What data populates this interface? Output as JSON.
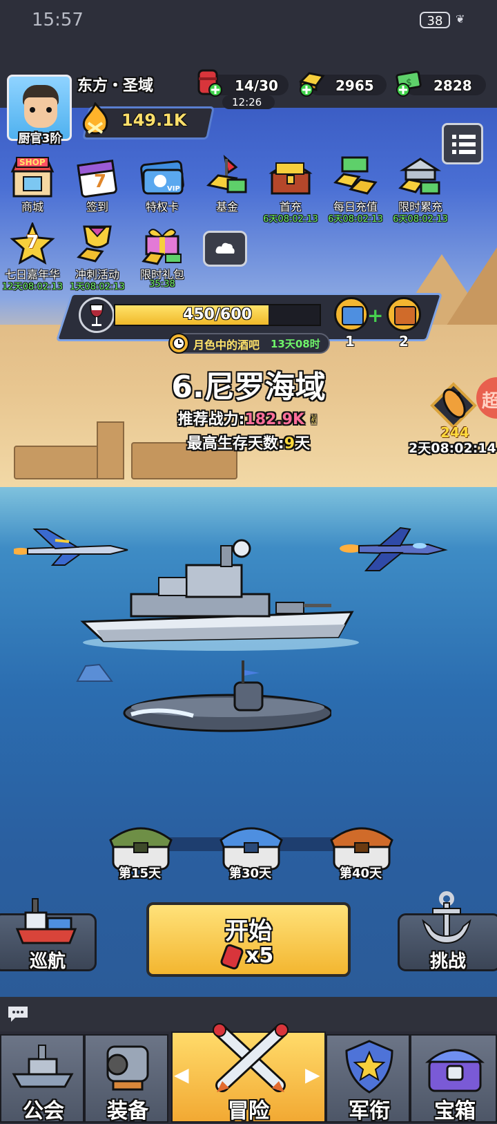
{
  "status_bar": {
    "time": "15:57",
    "battery": "38"
  },
  "player": {
    "name": "东方・圣域",
    "rank": "厨官3阶",
    "power": "149.1K"
  },
  "resources": [
    {
      "icon": "fuel-barrel-icon",
      "value": "14/30",
      "timer": "12:26"
    },
    {
      "icon": "gold-bars-icon",
      "value": "2965"
    },
    {
      "icon": "cash-icon",
      "value": "2828"
    }
  ],
  "menu_row1": [
    {
      "label": "商城",
      "icon": "shop-icon",
      "badge": "SHOP",
      "timer": ""
    },
    {
      "label": "签到",
      "icon": "calendar-icon",
      "badge": "7",
      "timer": ""
    },
    {
      "label": "特权卡",
      "icon": "vip-card-icon",
      "badge": "VIP",
      "timer": ""
    },
    {
      "label": "基金",
      "icon": "fund-icon",
      "timer": ""
    },
    {
      "label": "首充",
      "icon": "treasure-chest-icon",
      "timer": "6天08:02:13"
    },
    {
      "label": "每日充值",
      "icon": "gold-pile-icon",
      "timer": "6天08:02:13"
    },
    {
      "label": "限时累充",
      "icon": "vault-icon",
      "timer": "6天08:02:13"
    }
  ],
  "menu_row2": [
    {
      "label": "七日嘉年华",
      "icon": "seven-day-star-icon",
      "badge": "7",
      "timer": "12天08:02:13"
    },
    {
      "label": "冲刺活动",
      "icon": "sprint-trophy-icon",
      "timer": "1天08:02:13"
    },
    {
      "label": "限时礼包",
      "icon": "gift-box-icon",
      "timer": "35:38"
    }
  ],
  "event": {
    "progress_text": "450/600",
    "progress_fraction": 0.75,
    "name": "月色中的酒吧",
    "time_left": "13天08时",
    "chest1_count": "1",
    "chest2_count": "2"
  },
  "stage": {
    "title": "6.尼罗海域",
    "recommend_label": "推荐战力:",
    "recommend_value": "182.9K",
    "best_label": "最高生存天数:",
    "best_value": "9",
    "best_unit": "天"
  },
  "side_event": {
    "count": "244",
    "timer": "2天08:02:14",
    "edge_label": "超"
  },
  "milestones": [
    {
      "label": "第15天"
    },
    {
      "label": "第30天"
    },
    {
      "label": "第40天"
    }
  ],
  "buttons": {
    "cruise": "巡航",
    "start": "开始",
    "start_cost": "x5",
    "challenge": "挑战"
  },
  "nav": [
    {
      "label": "公会",
      "icon": "warship-icon"
    },
    {
      "label": "装备",
      "icon": "turret-icon"
    },
    {
      "label": "冒险",
      "icon": "crossed-missiles-icon",
      "active": true
    },
    {
      "label": "军衔",
      "icon": "rank-badge-icon"
    },
    {
      "label": "宝箱",
      "icon": "chest-icon"
    }
  ],
  "colors": {
    "accent_gold": "#f3b630",
    "timer_green": "#6ff56a",
    "power_pink": "#ff6f9a",
    "best_yellow": "#ffd93b",
    "nav_active": "#f2c94c"
  }
}
